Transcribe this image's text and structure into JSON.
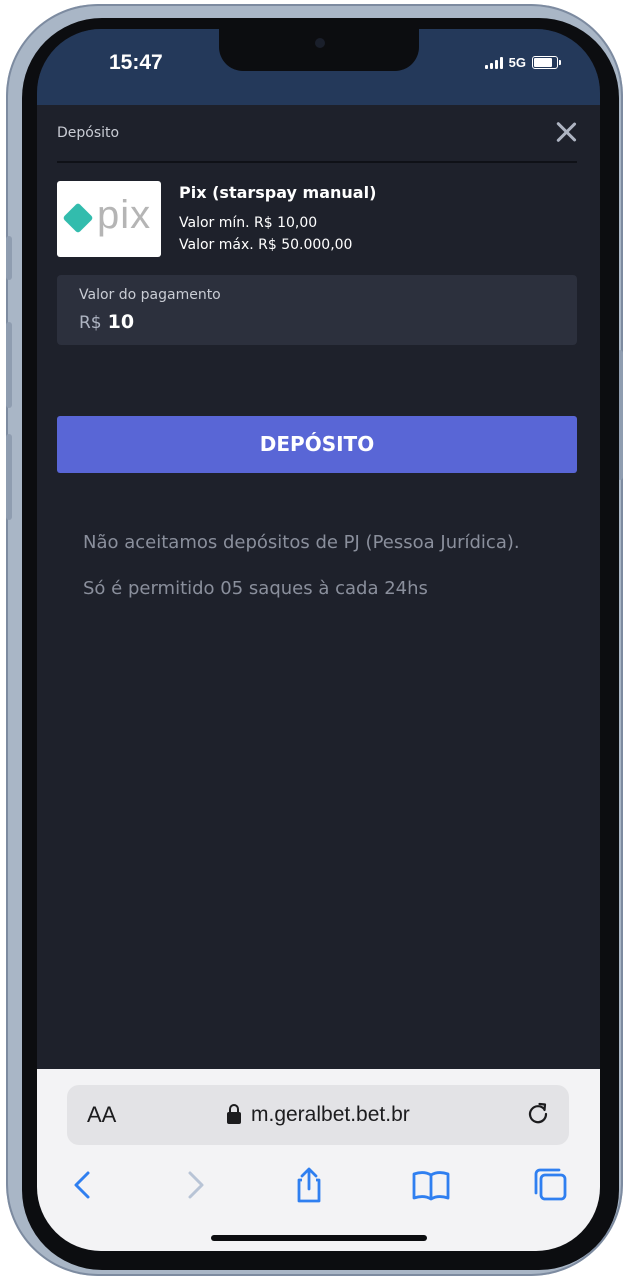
{
  "status_bar": {
    "time": "15:47",
    "network": "5G"
  },
  "modal": {
    "title": "Depósito",
    "method": {
      "name": "Pix (starspay manual)",
      "min": "Valor mín. R$ 10,00",
      "max": "Valor máx. R$ 50.000,00",
      "logo_text": "pix"
    },
    "amount": {
      "label": "Valor do pagamento",
      "currency": "R$",
      "value": "10"
    },
    "deposit_button": "DEPÓSITO",
    "notices": [
      "Não aceitamos depósitos de PJ (Pessoa Jurídica).",
      "Só é permitido 05 saques à cada 24hs"
    ]
  },
  "browser": {
    "aa_label": "AA",
    "url": "m.geralbet.bet.br"
  },
  "colors": {
    "accent": "#5966d6",
    "background": "#1e212b",
    "status_bar": "#24395a",
    "pix": "#32bcad",
    "safari_blue": "#2f7ff0"
  }
}
